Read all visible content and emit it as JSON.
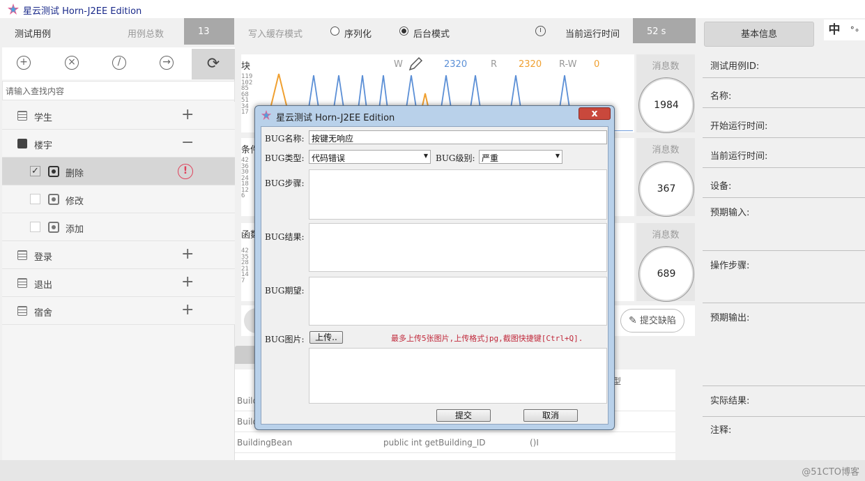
{
  "app": {
    "title": "星云测试 Horn-J2EE Edition"
  },
  "toolbar": {
    "test_case": "测试用例",
    "case_total_label": "用例总数",
    "case_total": "13",
    "write_cache_label": "写入缓存模式",
    "serial_label": "序列化",
    "background_label": "后台模式",
    "runtime_label": "当前运行时间",
    "runtime_value": "52 s",
    "info_tab": "基本信息",
    "lang_btn": "中",
    "dots_btn": "°∘"
  },
  "left": {
    "search_placeholder": "请输入查找内容",
    "tree": [
      {
        "label": "学生",
        "action": "+"
      },
      {
        "label": "楼宇",
        "action": "−"
      },
      {
        "label": "删除",
        "checked": true,
        "warn": "!"
      },
      {
        "label": "修改",
        "checked": false
      },
      {
        "label": "添加",
        "checked": false
      },
      {
        "label": "登录",
        "action": "+"
      },
      {
        "label": "退出",
        "action": "+"
      },
      {
        "label": "宿舍",
        "action": "+"
      }
    ]
  },
  "panels": {
    "block": {
      "title": "块",
      "yticks": [
        "119",
        "102",
        "85",
        "68",
        "51",
        "34",
        "17"
      ],
      "w_label": "W",
      "w_value": "2320",
      "r_label": "R",
      "r_value": "2320",
      "rw_label": "R-W",
      "rw_value": "0"
    },
    "cond": {
      "title": "条件",
      "yticks": [
        "42",
        "36",
        "30",
        "24",
        "18",
        "12",
        "6"
      ]
    },
    "func": {
      "title": "函数",
      "yticks": [
        "42",
        "35",
        "28",
        "21",
        "14",
        "7"
      ]
    },
    "msg": [
      {
        "label": "消息数",
        "value": "1984"
      },
      {
        "label": "消息数",
        "value": "367"
      },
      {
        "label": "消息数",
        "value": "689"
      }
    ],
    "submit_defect": "提交缺陷"
  },
  "table": {
    "rows": [
      {
        "c1": "Build",
        "c2": "",
        "c3": ""
      },
      {
        "c1": "Build",
        "c2": "",
        "c3": ""
      },
      {
        "c1": "BuildingBean",
        "c2": "public  int getBuilding_ID",
        "c3": "()I"
      }
    ],
    "partial_header": "型"
  },
  "right": {
    "fields": [
      "测试用例ID:",
      "名称:",
      "开始运行时间:",
      "当前运行时间:",
      "设备:",
      "预期输入:",
      "操作步骤:",
      "预期输出:",
      "实际结果:",
      "注释:"
    ]
  },
  "dialog": {
    "title": "星云测试 Horn-J2EE Edition",
    "close": "x",
    "bug_name_label": "BUG名称:",
    "bug_name_value": "按键无响应",
    "bug_type_label": "BUG类型:",
    "bug_type_value": "代码错误",
    "bug_level_label": "BUG级别:",
    "bug_level_value": "严重",
    "bug_steps_label": "BUG步骤:",
    "bug_result_label": "BUG结果:",
    "bug_expect_label": "BUG期望:",
    "bug_image_label": "BUG图片:",
    "upload_btn": "上传..",
    "upload_hint": "最多上传5张图片,上传格式jpg,截图快捷键[Ctrl+Q].",
    "submit_btn": "提交",
    "cancel_btn": "取消"
  },
  "status": {
    "watermark": "@51CTO博客"
  },
  "colors": {
    "w_series": "#5b8fd6",
    "r_series": "#f0a030",
    "warn": "#e0405a",
    "dialog_frame": "#b9d1ea"
  }
}
